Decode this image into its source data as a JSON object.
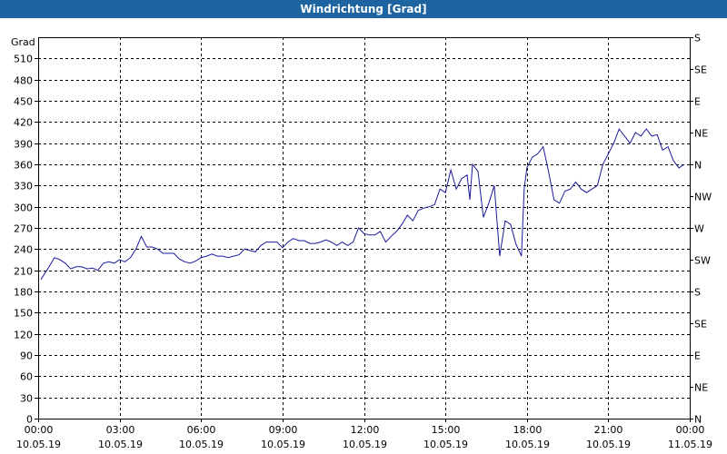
{
  "window": {
    "title": "Windrichtung [Grad]"
  },
  "colors": {
    "titlebar": "#1e64a0",
    "line": "#1a1a9c",
    "grid": "#000000"
  },
  "chart_data": {
    "type": "line",
    "title": "Windrichtung [Grad]",
    "ylabel": "Grad",
    "ylim": [
      0,
      540
    ],
    "xlim_hours": [
      0,
      24
    ],
    "grid": true,
    "y_ticks": [
      0,
      30,
      60,
      90,
      120,
      150,
      180,
      210,
      240,
      270,
      300,
      330,
      360,
      390,
      420,
      450,
      480,
      510
    ],
    "y2_ticks": [
      {
        "value": 0,
        "label": "N"
      },
      {
        "value": 45,
        "label": "NE"
      },
      {
        "value": 90,
        "label": "E"
      },
      {
        "value": 135,
        "label": "SE"
      },
      {
        "value": 180,
        "label": "S"
      },
      {
        "value": 225,
        "label": "SW"
      },
      {
        "value": 270,
        "label": "W"
      },
      {
        "value": 315,
        "label": "NW"
      },
      {
        "value": 360,
        "label": "N"
      },
      {
        "value": 405,
        "label": "NE"
      },
      {
        "value": 450,
        "label": "E"
      },
      {
        "value": 495,
        "label": "SE"
      },
      {
        "value": 540,
        "label": "S"
      }
    ],
    "x_ticks": [
      {
        "hour": 0,
        "time": "00:00",
        "date": "10.05.19"
      },
      {
        "hour": 3,
        "time": "03:00",
        "date": "10.05.19"
      },
      {
        "hour": 6,
        "time": "06:00",
        "date": "10.05.19"
      },
      {
        "hour": 9,
        "time": "09:00",
        "date": "10.05.19"
      },
      {
        "hour": 12,
        "time": "12:00",
        "date": "10.05.19"
      },
      {
        "hour": 15,
        "time": "15:00",
        "date": "10.05.19"
      },
      {
        "hour": 18,
        "time": "18:00",
        "date": "10.05.19"
      },
      {
        "hour": 21,
        "time": "21:00",
        "date": "10.05.19"
      },
      {
        "hour": 24,
        "time": "00:00",
        "date": "11.05.19"
      }
    ],
    "series": [
      {
        "x_hours": [
          0.1,
          0.4,
          0.6,
          0.8,
          1.0,
          1.2,
          1.4,
          1.6,
          1.8,
          2.0,
          2.2,
          2.4,
          2.6,
          2.8,
          3.0,
          3.2,
          3.4,
          3.6,
          3.8,
          4.0,
          4.2,
          4.4,
          4.6,
          4.8,
          5.0,
          5.2,
          5.4,
          5.6,
          5.8,
          6.0,
          6.2,
          6.4,
          6.6,
          6.8,
          7.0,
          7.2,
          7.4,
          7.6,
          7.8,
          8.0,
          8.2,
          8.4,
          8.6,
          8.8,
          9.0,
          9.2,
          9.4,
          9.6,
          9.8,
          10.0,
          10.2,
          10.4,
          10.6,
          10.8,
          11.0,
          11.2,
          11.4,
          11.6,
          11.8,
          12.0,
          12.2,
          12.4,
          12.6,
          12.8,
          13.0,
          13.2,
          13.4,
          13.6,
          13.8,
          14.0,
          14.2,
          14.4,
          14.6,
          14.8,
          15.0,
          15.2,
          15.4,
          15.6,
          15.8,
          15.9,
          16.0,
          16.2,
          16.4,
          16.6,
          16.8,
          17.0,
          17.2,
          17.4,
          17.6,
          17.8,
          17.9,
          18.0,
          18.2,
          18.4,
          18.6,
          18.8,
          19.0,
          19.2,
          19.4,
          19.6,
          19.8,
          20.0,
          20.2,
          20.4,
          20.6,
          20.8,
          21.0,
          21.2,
          21.4,
          21.6,
          21.8,
          22.0,
          22.2,
          22.4,
          22.6,
          22.8,
          23.0,
          23.2,
          23.4,
          23.6,
          23.8
        ],
        "values": [
          197,
          215,
          228,
          225,
          220,
          212,
          215,
          215,
          212,
          213,
          210,
          220,
          222,
          220,
          225,
          222,
          228,
          240,
          258,
          243,
          243,
          240,
          234,
          234,
          234,
          226,
          222,
          220,
          223,
          228,
          230,
          233,
          230,
          230,
          228,
          230,
          232,
          240,
          238,
          236,
          245,
          250,
          250,
          250,
          242,
          250,
          255,
          252,
          252,
          248,
          248,
          250,
          253,
          250,
          245,
          250,
          245,
          250,
          270,
          262,
          260,
          260,
          265,
          250,
          258,
          265,
          275,
          288,
          280,
          295,
          298,
          300,
          303,
          325,
          320,
          352,
          325,
          340,
          345,
          310,
          360,
          350,
          285,
          305,
          330,
          230,
          280,
          275,
          247,
          230,
          325,
          355,
          370,
          375,
          385,
          350,
          310,
          305,
          322,
          325,
          335,
          325,
          320,
          325,
          330,
          360,
          375,
          390,
          410,
          400,
          390,
          405,
          400,
          410,
          400,
          402,
          380,
          385,
          365,
          355,
          360,
          360,
          360,
          360,
          360
        ]
      }
    ]
  }
}
